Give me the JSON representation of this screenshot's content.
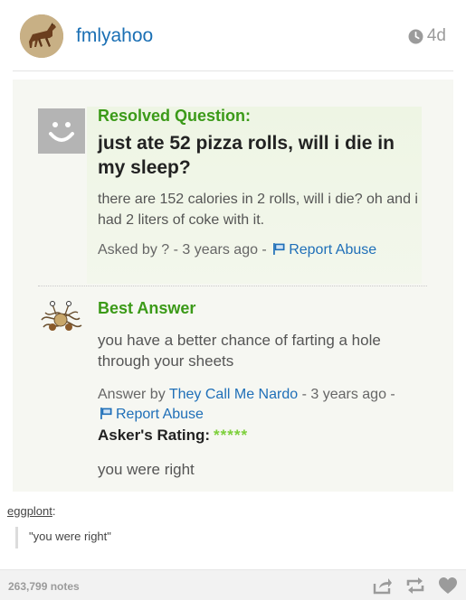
{
  "post": {
    "username": "fmlyahoo",
    "age": "4d"
  },
  "qa": {
    "resolved_label": "Resolved Question:",
    "question_title": "just ate 52 pizza rolls, will i die in my sleep?",
    "question_body": "there are 152 calories in 2 rolls, will i die? oh and i had 2 liters of coke with it.",
    "asked_by_prefix": "Asked by ? - 3 years ago - ",
    "report_abuse": "Report Abuse",
    "best_answer_label": "Best Answer",
    "answer_body": "you have a better chance of farting a hole through your sheets",
    "answer_by_prefix": "Answer by ",
    "answerer": "They Call Me Nardo",
    "answer_age": " - 3 years ago - ",
    "askers_rating_label": "Asker's Rating:",
    "rating_stars": "*****",
    "rating_value": 5,
    "asker_reply": "you were right"
  },
  "reblog": {
    "user": "eggplont",
    "quote": "\"you were right\""
  },
  "footer": {
    "notes": "263,799 notes"
  },
  "colors": {
    "username": "#1a6fb4",
    "green_label": "#3b9a18",
    "stars": "#7ccf3a",
    "link": "#1f6fb8"
  },
  "icons": [
    "clock-icon",
    "flag-icon",
    "share-icon",
    "reblog-icon",
    "heart-icon"
  ]
}
